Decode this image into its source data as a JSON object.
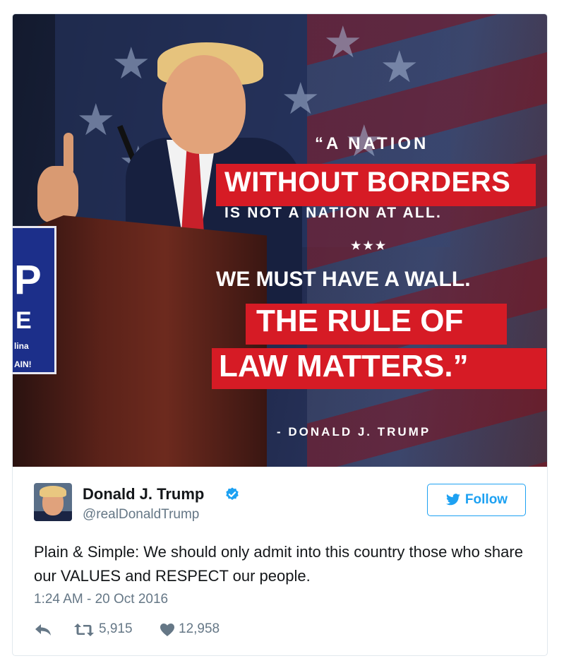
{
  "media": {
    "quote": {
      "line1": "“A NATION",
      "line2": "WITHOUT BORDERS",
      "line3": "IS NOT A NATION AT ALL.",
      "divider": "★★★",
      "line4": "WE MUST HAVE A WALL.",
      "line5": "THE RULE OF",
      "line6": "LAW MATTERS.”",
      "attribution": "- DONALD J. TRUMP"
    },
    "podium_sign": {
      "big": "P",
      "small": "E",
      "state": "lina",
      "tag": "AIN!"
    }
  },
  "user": {
    "name": "Donald J. Trump",
    "handle": "@realDonaldTrump",
    "verified": true
  },
  "follow_button": {
    "label": "Follow",
    "icon": "twitter-bird-icon"
  },
  "tweet": {
    "text": "Plain & Simple: We should only admit into this country those who share our VALUES and RESPECT our people.",
    "timestamp": "1:24 AM - 20 Oct 2016"
  },
  "actions": {
    "reply_icon": "reply-icon",
    "retweet_icon": "retweet-icon",
    "retweet_count": "5,915",
    "like_icon": "heart-icon",
    "like_count": "12,958"
  },
  "colors": {
    "twitter_blue": "#1da1f2",
    "quote_red": "#d61b25",
    "muted_text": "#657786",
    "border": "#e1e8ed"
  }
}
